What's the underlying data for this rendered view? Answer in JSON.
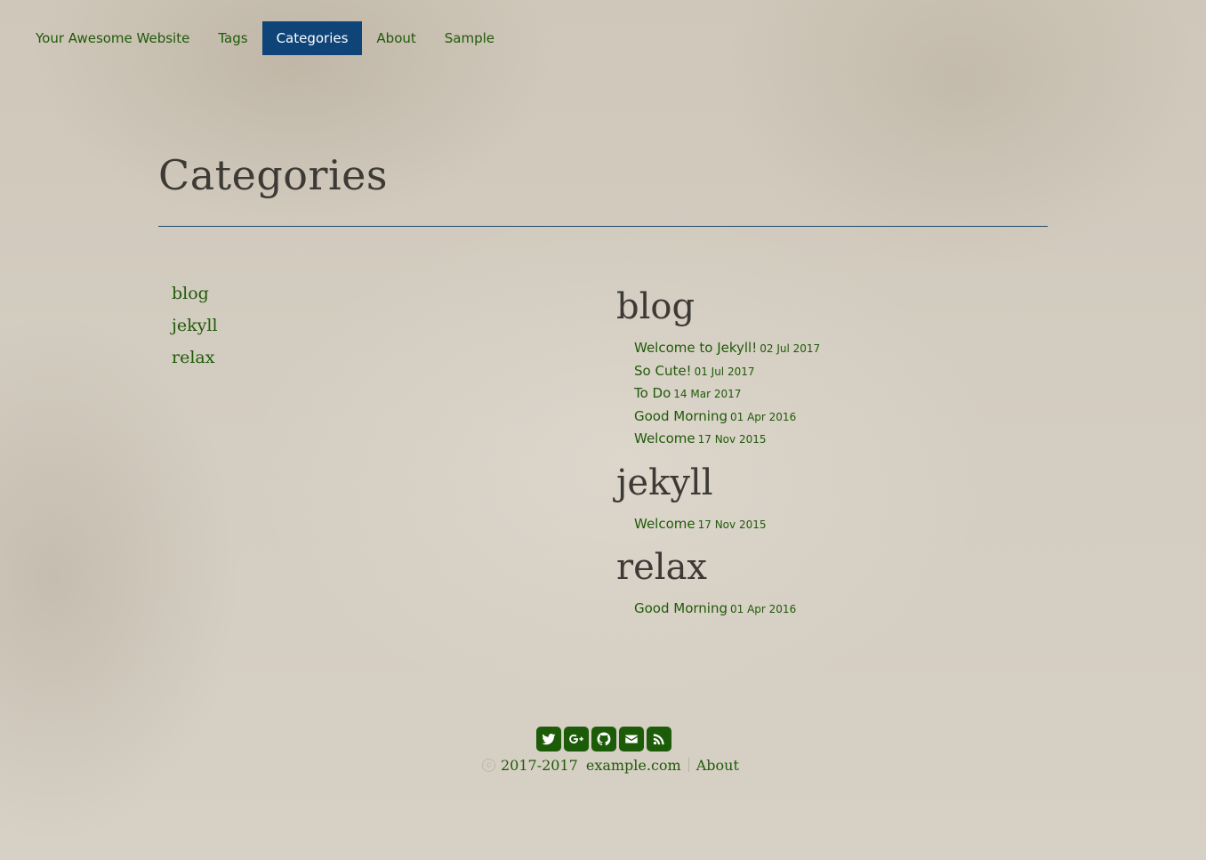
{
  "nav": {
    "items": [
      {
        "label": "Your Awesome Website"
      },
      {
        "label": "Tags"
      },
      {
        "label": "Categories"
      },
      {
        "label": "About"
      },
      {
        "label": "Sample"
      }
    ],
    "active": "Categories"
  },
  "page": {
    "title": "Categories"
  },
  "category_list": [
    "blog",
    "jekyll",
    "relax"
  ],
  "sections": {
    "blog": {
      "heading": "blog",
      "posts": [
        {
          "title": "Welcome to Jekyll!",
          "date": "02 Jul 2017"
        },
        {
          "title": "So Cute!",
          "date": "01 Jul 2017"
        },
        {
          "title": "To Do",
          "date": "14 Mar 2017"
        },
        {
          "title": "Good Morning",
          "date": "01 Apr 2016"
        },
        {
          "title": "Welcome",
          "date": "17 Nov 2015"
        }
      ]
    },
    "jekyll": {
      "heading": "jekyll",
      "posts": [
        {
          "title": "Welcome",
          "date": "17 Nov 2015"
        }
      ]
    },
    "relax": {
      "heading": "relax",
      "posts": [
        {
          "title": "Good Morning",
          "date": "01 Apr 2016"
        }
      ]
    }
  },
  "footer": {
    "social_icons": [
      "twitter-icon",
      "google-plus-icon",
      "github-icon",
      "email-icon",
      "rss-icon"
    ],
    "years": "2017-2017",
    "site": "example.com",
    "about": "About"
  },
  "colors": {
    "link": "#1f5a08",
    "nav_active_bg": "#0f4478",
    "rule": "#1f4a6e",
    "social_bg": "#1c5c08"
  }
}
